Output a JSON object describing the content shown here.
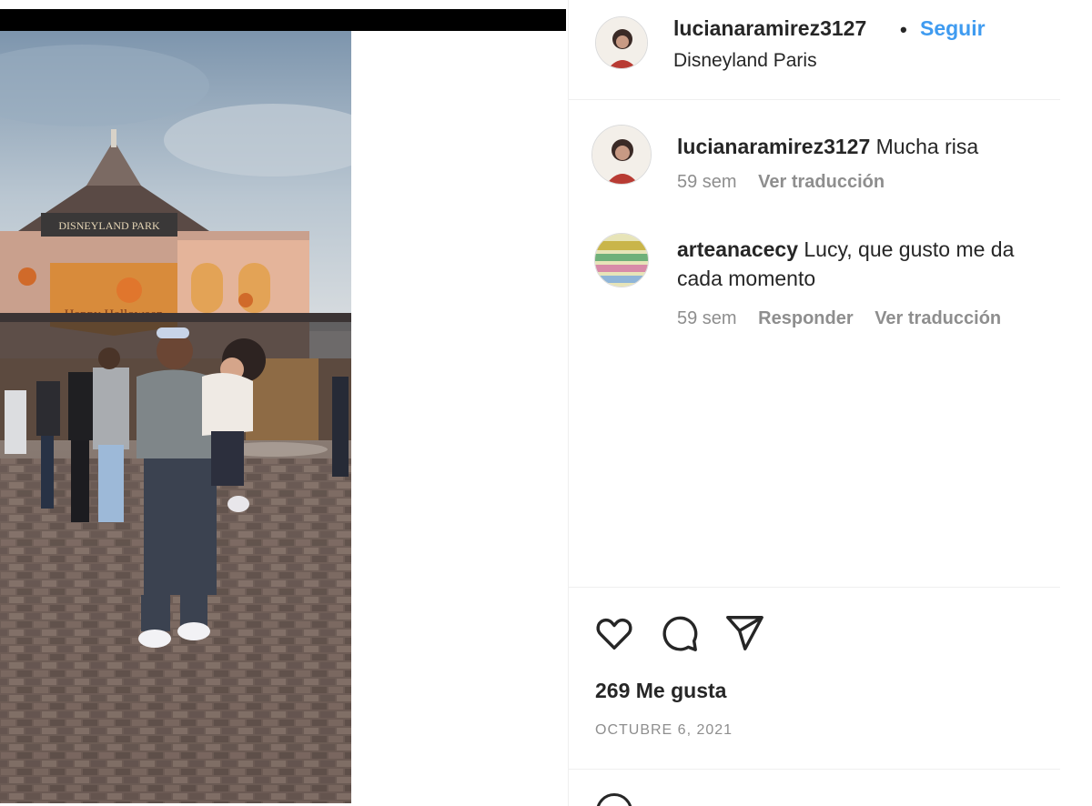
{
  "post": {
    "username": "lucianaramirez3127",
    "separator": "•",
    "follow_label": "Seguir",
    "location": "Disneyland Paris",
    "photo_sign_text": "DISNEYLAND PARK",
    "photo_banner_text": "Happy Halloween"
  },
  "comments": [
    {
      "username": "lucianaramirez3127",
      "text": " Mucha risa",
      "age": "59 sem",
      "translate_label": "Ver traducción"
    },
    {
      "username": "arteanacecy",
      "text": " Lucy, que gusto me da cada momento",
      "age": "59 sem",
      "reply_label": "Responder",
      "translate_label": "Ver traducción"
    }
  ],
  "actions": {
    "like_icon": "heart-icon",
    "comment_icon": "speech-bubble-icon",
    "share_icon": "paper-plane-icon"
  },
  "likes_text": "269 Me gusta",
  "date_text": "OCTUBRE 6, 2021",
  "colors": {
    "follow_blue": "#3f9bf0",
    "meta_gray": "#8e8e8e",
    "divider": "#efefef"
  }
}
